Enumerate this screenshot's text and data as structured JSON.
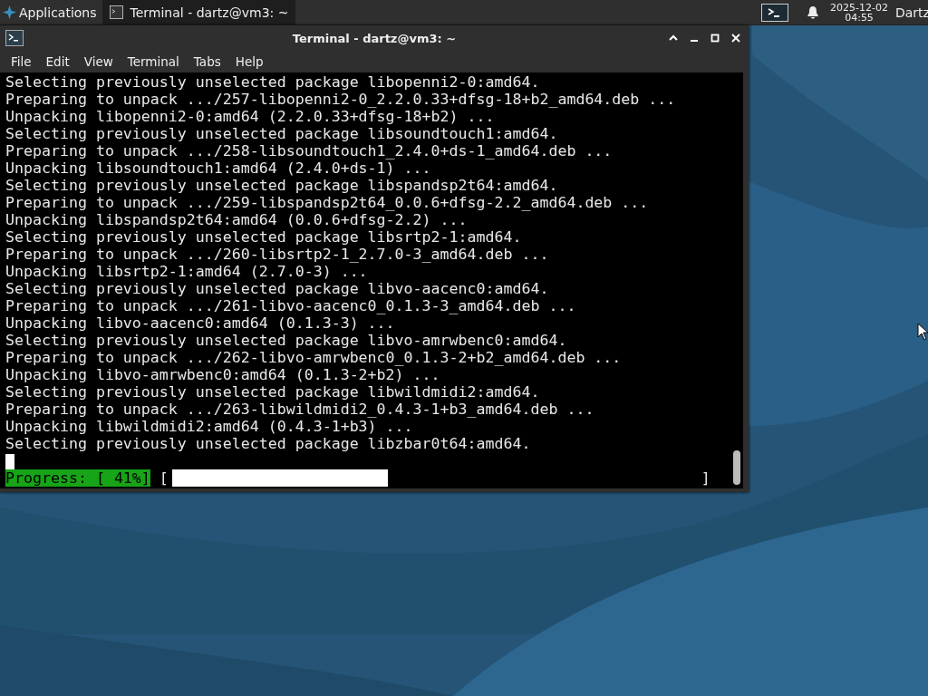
{
  "panel": {
    "applications": "Applications",
    "tasks": [
      {
        "label": "Terminal - dartz@vm3: ~",
        "selected": true
      }
    ],
    "clock": {
      "date": "2025-12-02",
      "time": "04:55"
    },
    "user": "Dartz"
  },
  "window": {
    "title": "Terminal - dartz@vm3: ~",
    "menu": [
      "File",
      "Edit",
      "View",
      "Terminal",
      "Tabs",
      "Help"
    ],
    "terminal": {
      "lines": [
        "Selecting previously unselected package libopenni2-0:amd64.",
        "Preparing to unpack .../257-libopenni2-0_2.2.0.33+dfsg-18+b2_amd64.deb ...",
        "Unpacking libopenni2-0:amd64 (2.2.0.33+dfsg-18+b2) ...",
        "Selecting previously unselected package libsoundtouch1:amd64.",
        "Preparing to unpack .../258-libsoundtouch1_2.4.0+ds-1_amd64.deb ...",
        "Unpacking libsoundtouch1:amd64 (2.4.0+ds-1) ...",
        "Selecting previously unselected package libspandsp2t64:amd64.",
        "Preparing to unpack .../259-libspandsp2t64_0.0.6+dfsg-2.2_amd64.deb ...",
        "Unpacking libspandsp2t64:amd64 (0.0.6+dfsg-2.2) ...",
        "Selecting previously unselected package libsrtp2-1:amd64.",
        "Preparing to unpack .../260-libsrtp2-1_2.7.0-3_amd64.deb ...",
        "Unpacking libsrtp2-1:amd64 (2.7.0-3) ...",
        "Selecting previously unselected package libvo-aacenc0:amd64.",
        "Preparing to unpack .../261-libvo-aacenc0_0.1.3-3_amd64.deb ...",
        "Unpacking libvo-aacenc0:amd64 (0.1.3-3) ...",
        "Selecting previously unselected package libvo-amrwbenc0:amd64.",
        "Preparing to unpack .../262-libvo-amrwbenc0_0.1.3-2+b2_amd64.deb ...",
        "Unpacking libvo-amrwbenc0:amd64 (0.1.3-2+b2) ...",
        "Selecting previously unselected package libwildmidi2:amd64.",
        "Preparing to unpack .../263-libwildmidi2_0.4.3-1+b3_amd64.deb ...",
        "Unpacking libwildmidi2:amd64 (0.4.3-1+b3) ...",
        "Selecting previously unselected package libzbar0t64:amd64."
      ],
      "progress": {
        "label": "Progress: [ 41%]",
        "open": "[",
        "close": "]",
        "level": 0.41
      }
    }
  }
}
